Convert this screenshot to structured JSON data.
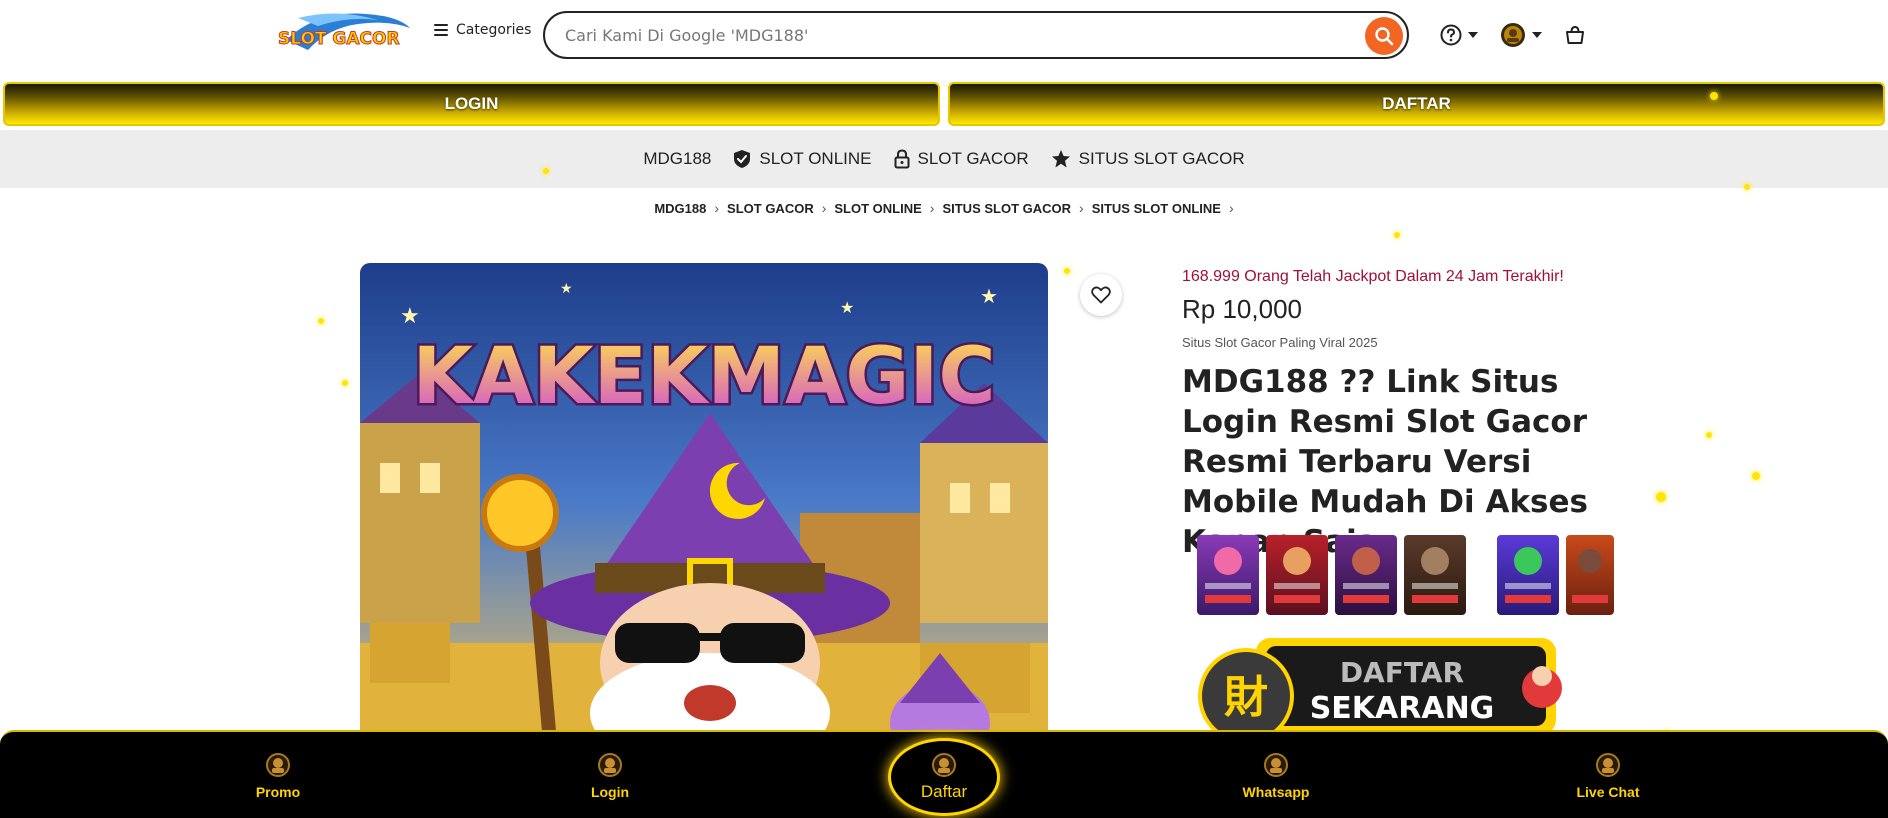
{
  "header": {
    "logo_text": "SLOT GACOR",
    "categories_label": "Categories",
    "search": {
      "placeholder": "Cari Kami Di Google 'MDG188'"
    }
  },
  "auth": {
    "login_label": "LOGIN",
    "daftar_label": "DAFTAR"
  },
  "nav": {
    "items": [
      {
        "label": "MDG188",
        "icon": ""
      },
      {
        "label": "SLOT ONLINE",
        "icon": "shield-check-icon"
      },
      {
        "label": "SLOT GACOR",
        "icon": "lock-icon"
      },
      {
        "label": "SITUS SLOT GACOR",
        "icon": "star-icon"
      }
    ]
  },
  "breadcrumb": {
    "items": [
      "MDG188",
      "SLOT GACOR",
      "SLOT ONLINE",
      "SITUS SLOT GACOR",
      "SITUS SLOT ONLINE"
    ]
  },
  "hero": {
    "image_text": "KAKEKMAGIC"
  },
  "product": {
    "jackpot_text": "168.999 Orang Telah Jackpot Dalam 24 Jam Terakhir!",
    "price": "Rp 10,000",
    "subtitle": "Situs Slot Gacor Paling Viral 2025",
    "title": "MDG188 ?? Link Situs Login Resmi Slot Gacor Resmi Terbaru Versi Mobile Mudah Di Akses Kapan Saja"
  },
  "banner": {
    "line1": "DAFTAR",
    "line2": "SEKARANG"
  },
  "bottom_nav": {
    "items": [
      {
        "label": "Promo"
      },
      {
        "label": "Login"
      },
      {
        "label": "Daftar"
      },
      {
        "label": "Whatsapp"
      },
      {
        "label": "Live Chat"
      }
    ]
  },
  "colors": {
    "accent": "#f26522",
    "gold": "#ffd400",
    "jackpot": "#a0103a"
  }
}
